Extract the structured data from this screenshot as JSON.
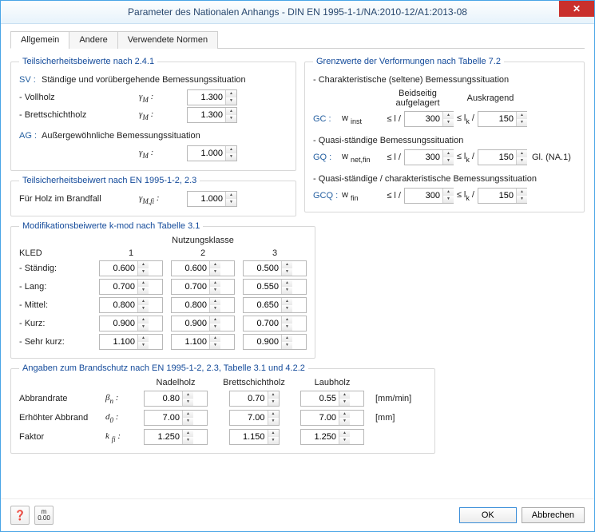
{
  "window": {
    "title": "Parameter des Nationalen Anhangs - DIN EN 1995-1-1/NA:2010-12/A1:2013-08"
  },
  "tabs": [
    "Allgemein",
    "Andere",
    "Verwendete Normen"
  ],
  "group1": {
    "legend": "Teilsicherheitsbeiwerte nach 2.4.1",
    "sv_prefix": "SV :",
    "sv_text": "Ständige und vorübergehende Bemessungssituation",
    "vollholz": "- Vollholz",
    "brettschicht": "- Brettschichtholz",
    "gamma_m": "γM :",
    "ag_prefix": "AG :",
    "ag_text": "Außergewöhnliche Bemessungssituation",
    "v_vollholz": "1.300",
    "v_brett": "1.300",
    "v_ag": "1.000"
  },
  "group2": {
    "legend": "Teilsicherheitsbeiwert nach EN 1995-1-2, 2.3",
    "label": "Für Holz im Brandfall",
    "gamma": "γM,fi :",
    "val": "1.000"
  },
  "group3": {
    "legend": "Grenzwerte der Verformungen nach Tabelle 7.2",
    "char": "- Charakteristische (seltene) Bemessungssituation",
    "col_beid": "Beidseitig aufgelagert",
    "col_aus": "Auskragend",
    "gc": "GC :",
    "w_inst": "w inst",
    "le_l": "≤ l /",
    "le_lk": "≤ lk /",
    "v_gc_l": "300",
    "v_gc_lk": "150",
    "quasi": "- Quasi-ständige Bemessungssituation",
    "gq": "GQ :",
    "w_netfin": "w net,fin",
    "v_gq_l": "300",
    "v_gq_lk": "150",
    "gl": "Gl. (NA.1)",
    "quasichar": "- Quasi-ständige / charakteristische Bemessungssituation",
    "gcq": "GCQ :",
    "w_fin": "w fin",
    "v_gcq_l": "300",
    "v_gcq_lk": "150"
  },
  "group4": {
    "legend": "Modifikationsbeiwerte k-mod nach Tabelle 3.1",
    "nutz": "Nutzungsklasse",
    "kled": "KLED",
    "c1": "1",
    "c2": "2",
    "c3": "3",
    "rows": [
      {
        "l": "- Ständig:",
        "v": [
          "0.600",
          "0.600",
          "0.500"
        ]
      },
      {
        "l": "- Lang:",
        "v": [
          "0.700",
          "0.700",
          "0.550"
        ]
      },
      {
        "l": "- Mittel:",
        "v": [
          "0.800",
          "0.800",
          "0.650"
        ]
      },
      {
        "l": "- Kurz:",
        "v": [
          "0.900",
          "0.900",
          "0.700"
        ]
      },
      {
        "l": "- Sehr kurz:",
        "v": [
          "1.100",
          "1.100",
          "0.900"
        ]
      }
    ]
  },
  "group5": {
    "legend": "Angaben zum Brandschutz nach EN 1995-1-2, 2.3, Tabelle 3.1 und 4.2.2",
    "h1": "Nadelholz",
    "h2": "Brettschichtholz",
    "h3": "Laubholz",
    "r1": "Abbrandrate",
    "r1s": "βn :",
    "r1v": [
      "0.80",
      "0.70",
      "0.55"
    ],
    "r1u": "[mm/min]",
    "r2": "Erhöhter Abbrand",
    "r2s": "d0 :",
    "r2v": [
      "7.00",
      "7.00",
      "7.00"
    ],
    "r2u": "[mm]",
    "r3": "Faktor",
    "r3s": "k fi :",
    "r3v": [
      "1.250",
      "1.150",
      "1.250"
    ]
  },
  "footer": {
    "ok": "OK",
    "cancel": "Abbrechen"
  }
}
